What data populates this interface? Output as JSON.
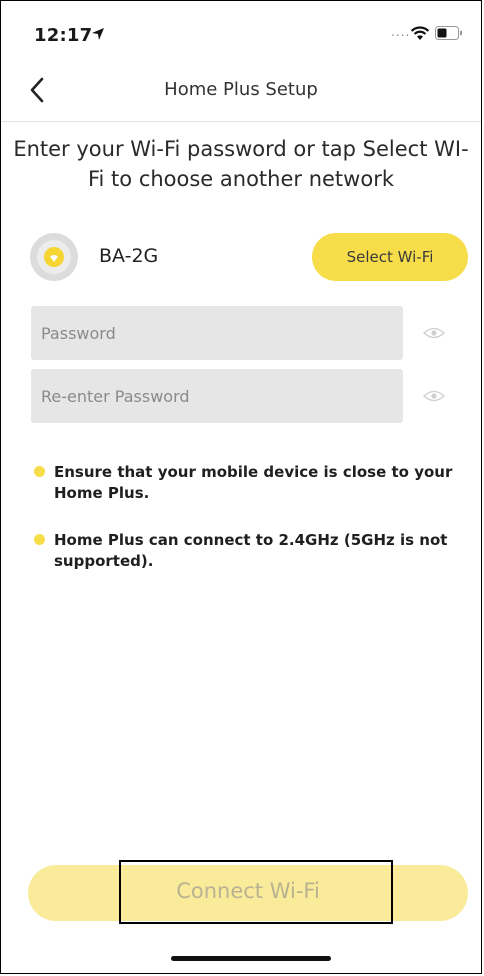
{
  "status_bar": {
    "time": "12:17",
    "signal_dots": "....",
    "icons": [
      "location-arrow-icon",
      "wifi-icon",
      "battery-icon"
    ]
  },
  "nav": {
    "title": "Home Plus Setup",
    "back_icon": "chevron-left-icon"
  },
  "instruction": "Enter your Wi-Fi password or tap Select WI-Fi to choose another network",
  "network": {
    "icon": "wifi-network-icon",
    "name": "BA-2G",
    "select_label": "Select Wi-Fi"
  },
  "fields": {
    "password": {
      "placeholder": "Password",
      "value": ""
    },
    "reenter": {
      "placeholder": "Re-enter Password",
      "value": ""
    },
    "toggle_icon": "eye-icon"
  },
  "notes": [
    "Ensure that your mobile device is close to your Home Plus.",
    "Home Plus can connect to 2.4GHz (5GHz is not supported)."
  ],
  "connect": {
    "label": "Connect Wi-Fi"
  },
  "colors": {
    "accent": "#f8dd4a",
    "accent_disabled": "#faeb9b",
    "field_bg": "#e6e6e6"
  }
}
